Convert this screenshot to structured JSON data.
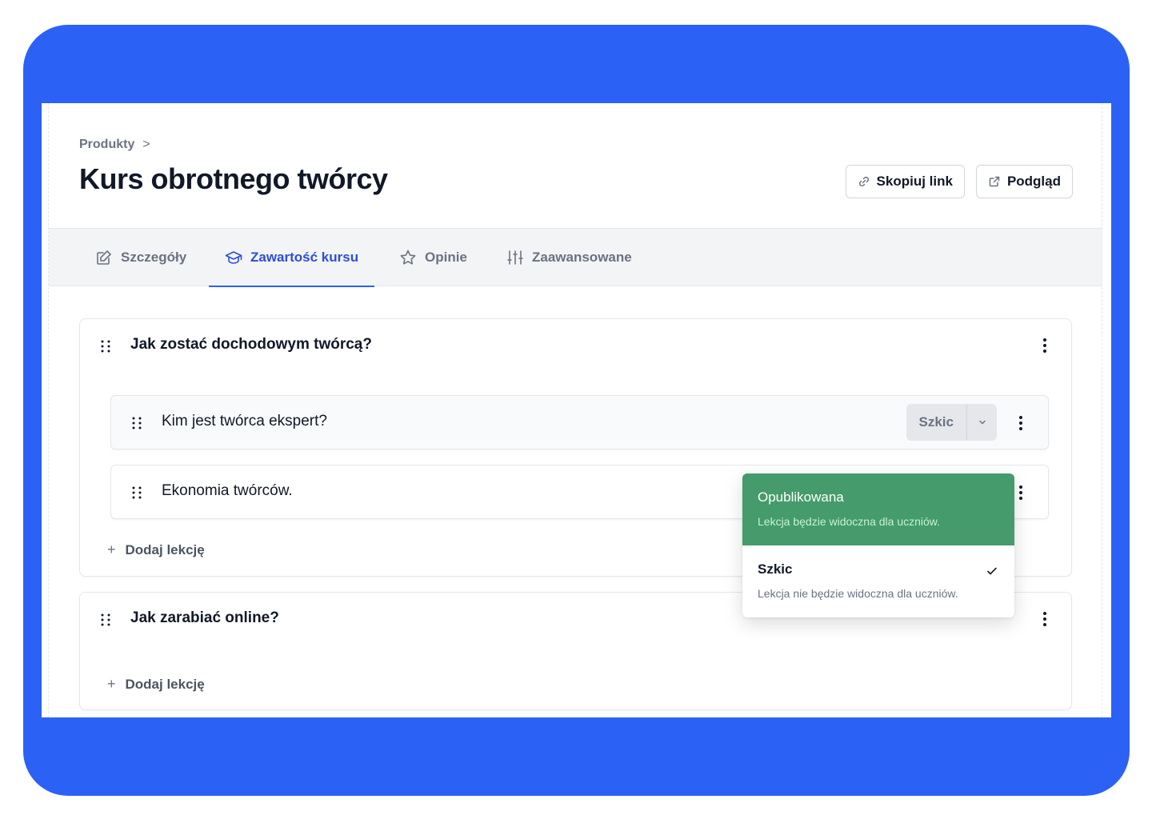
{
  "header": {
    "breadcrumb": "Produkty",
    "title": "Kurs obrotnego twórcy",
    "copy_link_label": "Skopiuj link",
    "preview_label": "Podgląd"
  },
  "tabs": [
    {
      "label": "Szczegóły",
      "icon": "edit-square-icon",
      "active": false
    },
    {
      "label": "Zawartość kursu",
      "icon": "graduation-cap-icon",
      "active": true
    },
    {
      "label": "Opinie",
      "icon": "star-icon",
      "active": false
    },
    {
      "label": "Zaawansowane",
      "icon": "sliders-icon",
      "active": false
    }
  ],
  "sections": [
    {
      "title": "Jak zostać dochodowym twórcą?",
      "lessons": [
        {
          "title": "Kim jest twórca ekspert?",
          "status": "Szkic"
        },
        {
          "title": "Ekonomia twórców."
        }
      ],
      "add_lesson_label": "Dodaj lekcję"
    },
    {
      "title": "Jak zarabiać online?",
      "lessons": [],
      "add_lesson_label": "Dodaj lekcję"
    }
  ],
  "status_dropdown": {
    "options": [
      {
        "title": "Opublikowana",
        "description": "Lekcja będzie widoczna dla uczniów.",
        "highlighted": true
      },
      {
        "title": "Szkic",
        "description": "Lekcja nie będzie widoczna dla uczniów.",
        "selected": true
      }
    ]
  },
  "colors": {
    "frame": "#2b62f5",
    "accent": "#2b4fd8",
    "published": "#459b6b"
  }
}
